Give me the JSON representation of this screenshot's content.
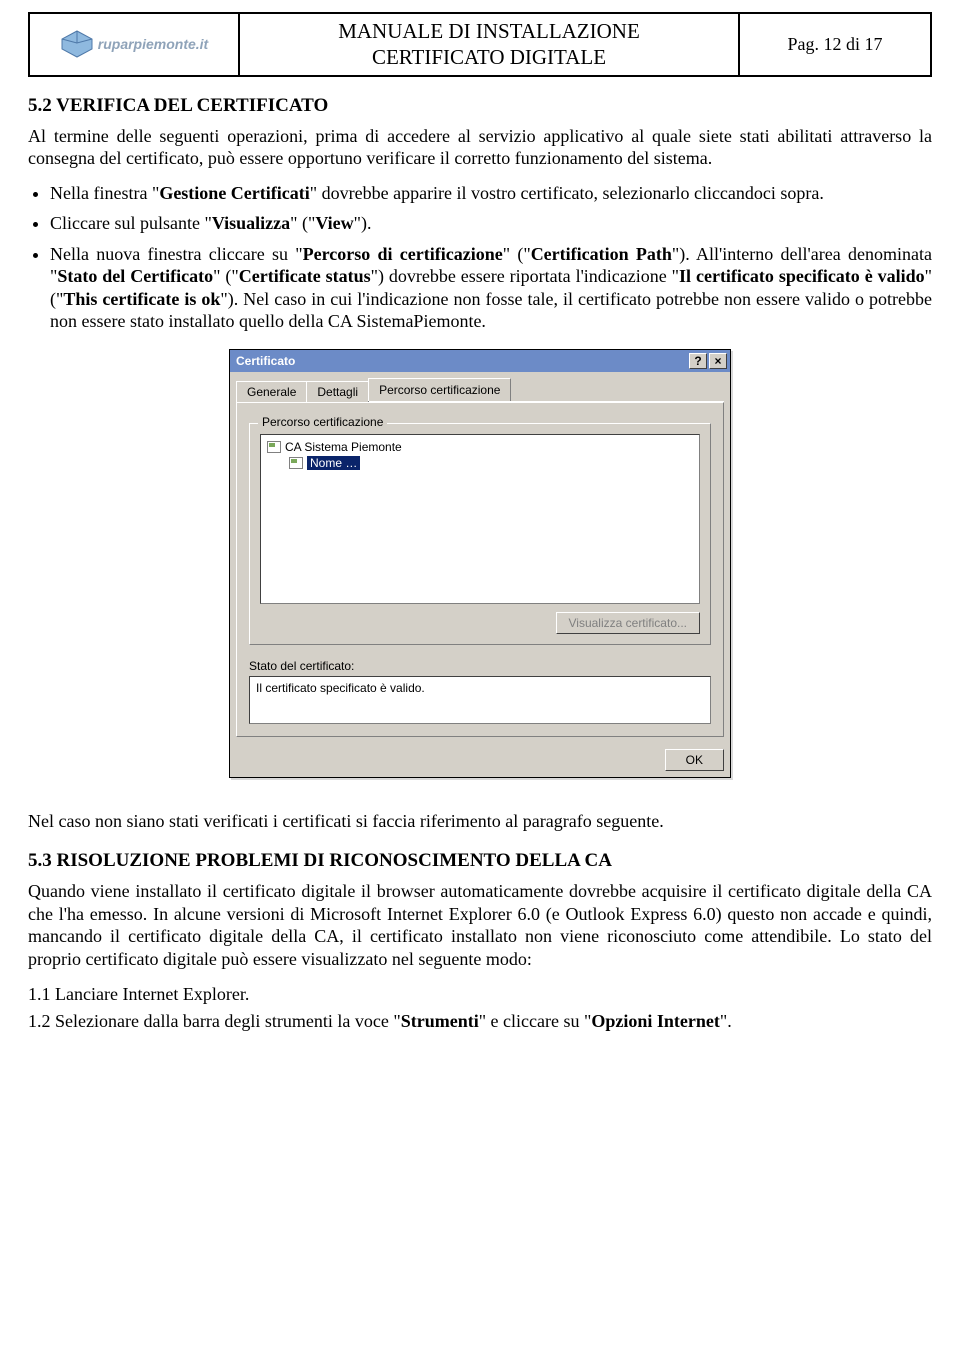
{
  "header": {
    "logo_text": "ruparpiemonte.it",
    "title_line1": "MANUALE DI INSTALLAZIONE",
    "title_line2": "CERTIFICATO DIGITALE",
    "page_label": "Pag. 12 di 17"
  },
  "sec52": {
    "heading": "5.2 VERIFICA DEL CERTIFICATO",
    "intro": "Al termine delle seguenti operazioni, prima di accedere al servizio applicativo al quale siete stati abilitati attraverso la consegna del certificato, può essere opportuno verificare il corretto funzionamento del sistema.",
    "bullets": {
      "b1_pre": "Nella finestra \"",
      "b1_bold": "Gestione Certificati",
      "b1_post": "\" dovrebbe apparire il vostro certificato, selezionarlo cliccandoci sopra.",
      "b2_pre": "Cliccare sul pulsante \"",
      "b2_bold1": "Visualizza",
      "b2_mid": "\" (\"",
      "b2_bold2": "View",
      "b2_post": "\").",
      "b3_pre": "Nella nuova finestra cliccare su \"",
      "b3_bold1": "Percorso di certificazione",
      "b3_mid1": "\" (\"",
      "b3_bold2": "Certification Path",
      "b3_mid2": "\"). All'interno dell'area denominata \"",
      "b3_bold3": "Stato del Certificato",
      "b3_mid3": "\" (\"",
      "b3_bold4": "Certificate status",
      "b3_mid4": "\") dovrebbe essere riportata l'indicazione \"",
      "b3_bold5": "Il certificato specificato è valido",
      "b3_mid5": "\" (\"",
      "b3_bold6": "This certificate is ok",
      "b3_post": "\"). Nel caso in cui l'indicazione non fosse tale, il certificato potrebbe non essere valido o potrebbe non essere stato installato quello della CA SistemaPiemonte."
    }
  },
  "dialog": {
    "title": "Certificato",
    "help_btn": "?",
    "close_btn": "×",
    "tabs": {
      "general": "Generale",
      "details": "Dettagli",
      "path": "Percorso certificazione"
    },
    "group_legend": "Percorso certificazione",
    "tree_root": "CA Sistema Piemonte",
    "tree_child": "Nome …",
    "view_cert_btn": "Visualizza certificato...",
    "status_label": "Stato del certificato:",
    "status_value": "Il certificato specificato è valido.",
    "ok_btn": "OK"
  },
  "after_dialog": "Nel caso non siano stati verificati i certificati si faccia riferimento al paragrafo seguente.",
  "sec53": {
    "heading": "5.3 RISOLUZIONE PROBLEMI DI RICONOSCIMENTO DELLA CA",
    "body": "Quando viene installato il certificato digitale il browser automaticamente dovrebbe acquisire il certificato digitale della CA che l'ha emesso. In alcune versioni di Microsoft Internet Explorer 6.0 (e Outlook Express 6.0) questo non accade e quindi, mancando il certificato digitale della CA, il certificato installato non viene riconosciuto come attendibile. Lo stato del proprio certificato digitale può essere visualizzato nel seguente modo:",
    "step1": "1.1 Lanciare Internet Explorer.",
    "step2_pre": "1.2 Selezionare dalla barra degli strumenti la voce \"",
    "step2_bold1": "Strumenti",
    "step2_mid": "\" e cliccare su \"",
    "step2_bold2": "Opzioni Internet",
    "step2_post": "\"."
  }
}
